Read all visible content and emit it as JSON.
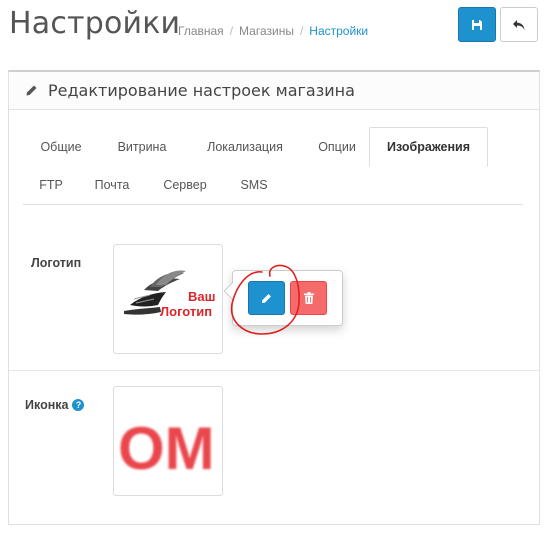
{
  "header": {
    "title": "Настройки",
    "breadcrumb": [
      "Главная",
      "Магазины",
      "Настройки"
    ]
  },
  "panel": {
    "title": "Редактирование настроек магазина"
  },
  "tabs": {
    "row1": [
      "Общие",
      "Витрина",
      "Локализация",
      "Опции",
      "Изображения"
    ],
    "row2": [
      "FTP",
      "Почта",
      "Сервер",
      "SMS"
    ],
    "active": "Изображения"
  },
  "form": {
    "logo_label": "Логотип",
    "icon_label": "Иконка",
    "logo_text": [
      "Ваш",
      "Логотип"
    ],
    "favicon_text": "ОМ"
  },
  "colors": {
    "primary": "#1e91cf",
    "danger": "#f56b6b",
    "annotation": "#e0201e"
  },
  "icons": [
    "save-icon",
    "reply-icon",
    "pencil-icon",
    "trash-icon",
    "question-icon"
  ]
}
